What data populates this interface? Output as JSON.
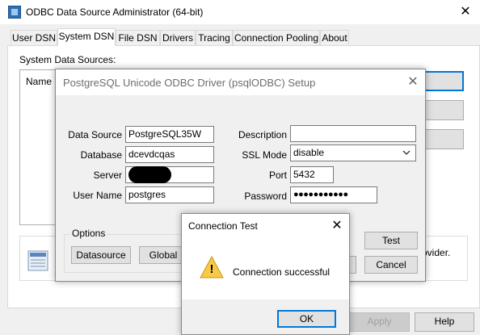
{
  "window": {
    "title": "ODBC Data Source Administrator (64-bit)",
    "close_glyph": "✕"
  },
  "tabs": [
    {
      "label": "User DSN"
    },
    {
      "label": "System DSN"
    },
    {
      "label": "File DSN"
    },
    {
      "label": "Drivers"
    },
    {
      "label": "Tracing"
    },
    {
      "label": "Connection Pooling"
    },
    {
      "label": "About"
    }
  ],
  "system_dsn": {
    "section_label": "System Data Sources:",
    "column_name": "Name",
    "info_text_fragment": "ovider."
  },
  "bottom_buttons": {
    "apply": "Apply",
    "help": "Help"
  },
  "setup_dialog": {
    "title": "PostgreSQL Unicode ODBC Driver (psqlODBC) Setup",
    "close_glyph": "✕",
    "fields": {
      "data_source": {
        "label": "Data Source",
        "value": "PostgreSQL35W"
      },
      "database": {
        "label": "Database",
        "value": "dcevdcqas"
      },
      "server": {
        "label": "Server",
        "value": ""
      },
      "user_name": {
        "label": "User Name",
        "value": "postgres"
      },
      "description": {
        "label": "Description",
        "value": ""
      },
      "ssl_mode": {
        "label": "SSL Mode",
        "value": "disable"
      },
      "port": {
        "label": "Port",
        "value": "5432"
      },
      "password": {
        "label": "Password",
        "value": "●●●●●●●●●●●"
      }
    },
    "options": {
      "label": "Options",
      "datasource_button": "Datasource",
      "global_button": "Global"
    },
    "test_button": "Test",
    "cancel_button": "Cancel"
  },
  "connection_test": {
    "title": "Connection Test",
    "close_glyph": "✕",
    "message": "Connection successful",
    "warning_glyph": "!",
    "ok_button": "OK"
  }
}
